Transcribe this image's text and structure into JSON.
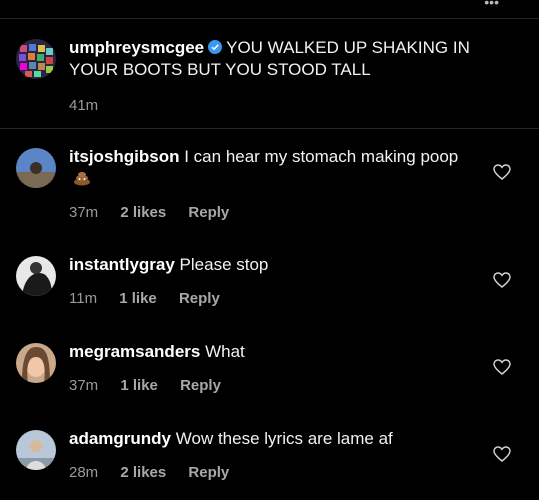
{
  "caption": {
    "username": "umphreysmcgee",
    "text": "YOU WALKED UP SHAKING IN YOUR BOOTS BUT YOU STOOD TALL",
    "time": "41m"
  },
  "comments": [
    {
      "username": "itsjoshgibson",
      "text": "I can hear my stomach making poop",
      "emoji": "poop-emoji",
      "time": "37m",
      "likes": "2 likes",
      "reply": "Reply"
    },
    {
      "username": "instantlygray",
      "text": "Please stop",
      "time": "11m",
      "likes": "1 like",
      "reply": "Reply"
    },
    {
      "username": "megramsanders",
      "text": "What",
      "time": "37m",
      "likes": "1 like",
      "reply": "Reply"
    },
    {
      "username": "adamgrundy",
      "text": "Wow these lyrics are lame af",
      "time": "28m",
      "likes": "2 likes",
      "reply": "Reply"
    }
  ],
  "colors": {
    "background": "#000000",
    "verified": "#3897f0",
    "secondary": "#9a9a9a"
  }
}
